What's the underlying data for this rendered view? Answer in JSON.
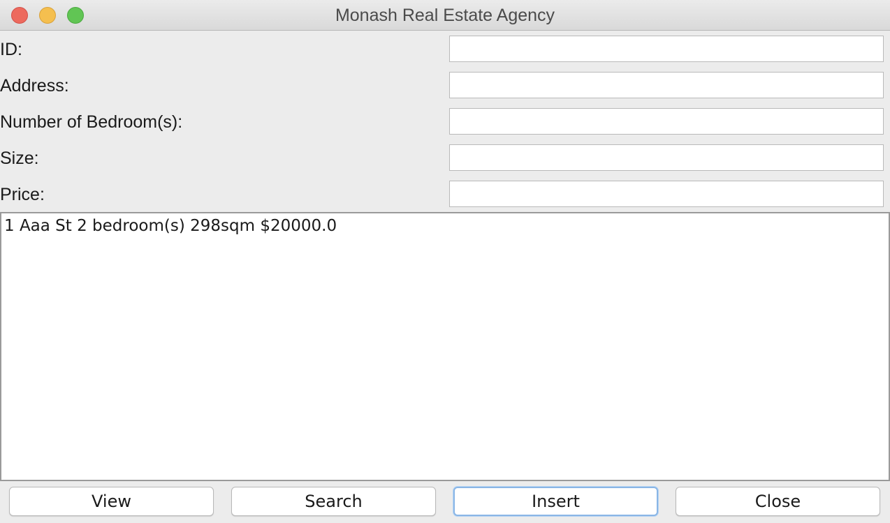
{
  "window": {
    "title": "Monash Real Estate Agency"
  },
  "form": {
    "fields": [
      {
        "label": "ID:",
        "value": ""
      },
      {
        "label": "Address:",
        "value": ""
      },
      {
        "label": "Number of Bedroom(s):",
        "value": ""
      },
      {
        "label": "Size:",
        "value": ""
      },
      {
        "label": "Price:",
        "value": ""
      }
    ]
  },
  "output": {
    "text": "1 Aaa St 2 bedroom(s) 298sqm $20000.0"
  },
  "buttons": {
    "view": "View",
    "search": "Search",
    "insert": "Insert",
    "close": "Close"
  },
  "colors": {
    "traffic_close": "#ed6a5e",
    "traffic_minimize": "#f5bf4f",
    "traffic_maximize": "#61c554",
    "focus_ring": "#8ab6e6"
  }
}
